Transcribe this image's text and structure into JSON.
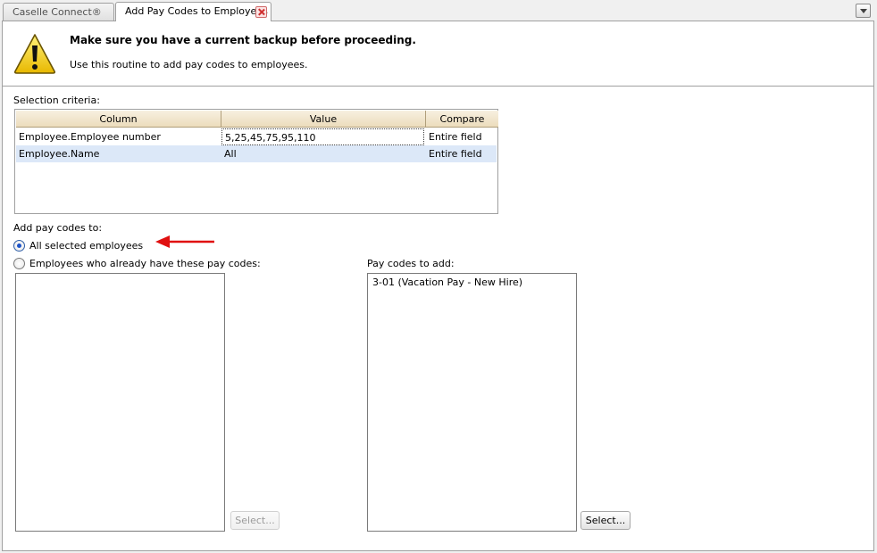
{
  "tabs": {
    "inactive_label": "Caselle Connect®",
    "active_label": "Add Pay Codes to Employees"
  },
  "warning": {
    "title": "Make sure you have a current backup before proceeding.",
    "subtitle": "Use this routine to add pay codes to employees."
  },
  "criteria": {
    "label": "Selection criteria:",
    "columns": [
      "Column",
      "Value",
      "Compare"
    ],
    "rows": [
      {
        "column": "Employee.Employee number",
        "value": "5,25,45,75,95,110",
        "compare": "Entire field"
      },
      {
        "column": "Employee.Name",
        "value": "All",
        "compare": "Entire field"
      }
    ]
  },
  "add_to": {
    "label": "Add pay codes to:",
    "option_all": "All selected employees",
    "option_existing": "Employees who already have these pay codes:",
    "selected": "all"
  },
  "employees_list": {
    "items": [],
    "select_label": "Select..."
  },
  "pay_codes": {
    "label": "Pay codes to add:",
    "items": [
      "3-01 (Vacation Pay - New Hire)"
    ],
    "select_label": "Select..."
  },
  "colors": {
    "accent_arrow": "#e01010",
    "selected_row": "#dce8f8",
    "header_grad": "#ecdcbc"
  }
}
